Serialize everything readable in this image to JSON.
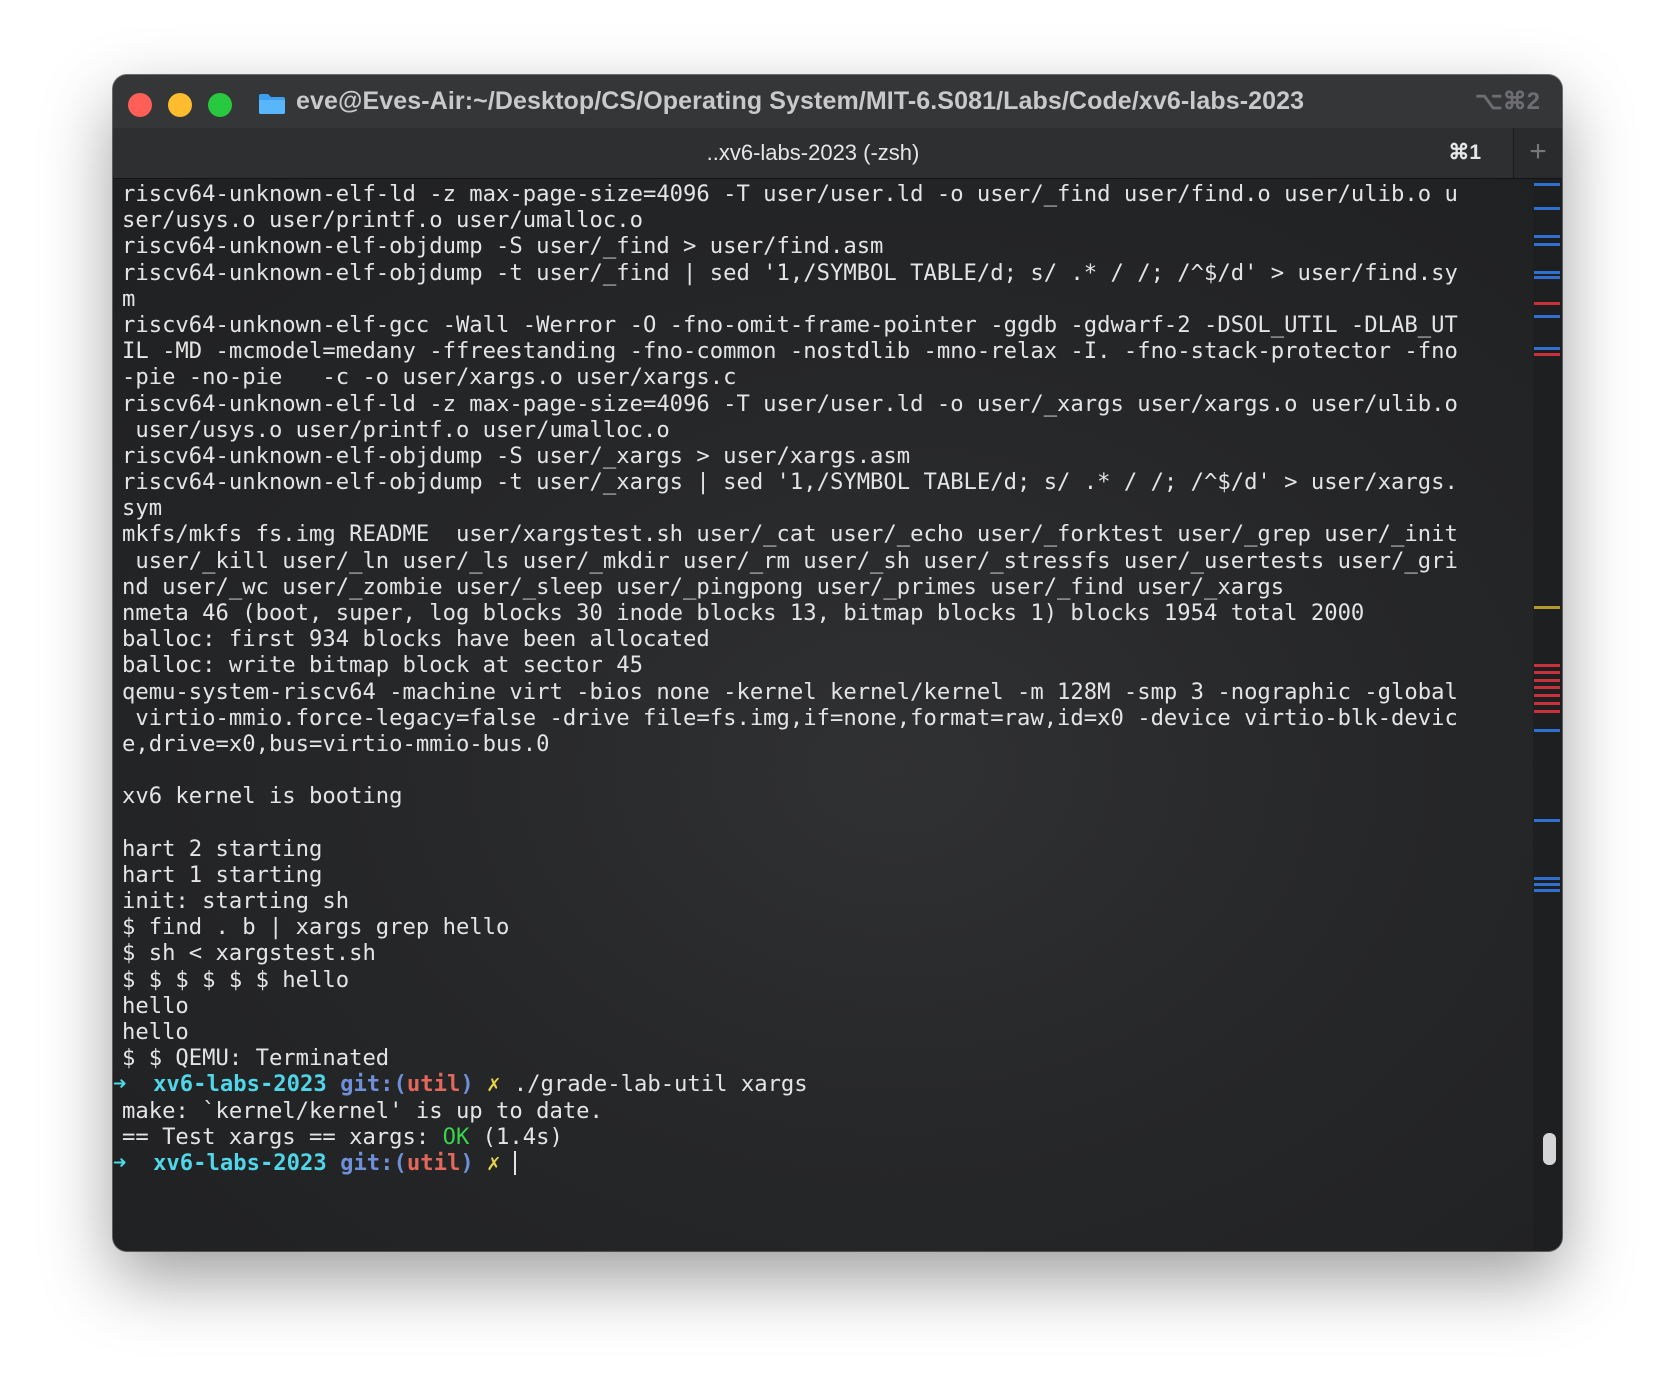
{
  "window": {
    "title": "eve@Eves-Air:~/Desktop/CS/Operating System/MIT-6.S081/Labs/Code/xv6-labs-2023",
    "shortcut": "⌥⌘2"
  },
  "tab": {
    "label": "..xv6-labs-2023 (-zsh)",
    "shortcut": "⌘1",
    "new_tab": "+"
  },
  "colors": {
    "prompt_arrow": "#4cd9e8",
    "prompt_dir": "#50d6e8",
    "prompt_git": "#6f8fd8",
    "prompt_branch": "#e2685c",
    "prompt_dirty": "#e6d34a",
    "ok": "#39d24f",
    "mark_blue": "#2f6fd0",
    "mark_red": "#c8303a"
  },
  "terminal": {
    "lines": [
      "riscv64-unknown-elf-ld -z max-page-size=4096 -T user/user.ld -o user/_find user/find.o user/ulib.o u",
      "ser/usys.o user/printf.o user/umalloc.o",
      "riscv64-unknown-elf-objdump -S user/_find > user/find.asm",
      "riscv64-unknown-elf-objdump -t user/_find | sed '1,/SYMBOL TABLE/d; s/ .* / /; /^$/d' > user/find.sy",
      "m",
      "riscv64-unknown-elf-gcc -Wall -Werror -O -fno-omit-frame-pointer -ggdb -gdwarf-2 -DSOL_UTIL -DLAB_UT",
      "IL -MD -mcmodel=medany -ffreestanding -fno-common -nostdlib -mno-relax -I. -fno-stack-protector -fno",
      "-pie -no-pie   -c -o user/xargs.o user/xargs.c",
      "riscv64-unknown-elf-ld -z max-page-size=4096 -T user/user.ld -o user/_xargs user/xargs.o user/ulib.o",
      " user/usys.o user/printf.o user/umalloc.o",
      "riscv64-unknown-elf-objdump -S user/_xargs > user/xargs.asm",
      "riscv64-unknown-elf-objdump -t user/_xargs | sed '1,/SYMBOL TABLE/d; s/ .* / /; /^$/d' > user/xargs.",
      "sym",
      "mkfs/mkfs fs.img README  user/xargstest.sh user/_cat user/_echo user/_forktest user/_grep user/_init",
      " user/_kill user/_ln user/_ls user/_mkdir user/_rm user/_sh user/_stressfs user/_usertests user/_gri",
      "nd user/_wc user/_zombie user/_sleep user/_pingpong user/_primes user/_find user/_xargs",
      "nmeta 46 (boot, super, log blocks 30 inode blocks 13, bitmap blocks 1) blocks 1954 total 2000",
      "balloc: first 934 blocks have been allocated",
      "balloc: write bitmap block at sector 45",
      "qemu-system-riscv64 -machine virt -bios none -kernel kernel/kernel -m 128M -smp 3 -nographic -global",
      " virtio-mmio.force-legacy=false -drive file=fs.img,if=none,format=raw,id=x0 -device virtio-blk-devic",
      "e,drive=x0,bus=virtio-mmio-bus.0",
      "",
      "xv6 kernel is booting",
      "",
      "hart 2 starting",
      "hart 1 starting",
      "init: starting sh",
      "$ find . b | xargs grep hello",
      "$ sh < xargstest.sh",
      "$ $ $ $ $ $ hello",
      "hello",
      "hello",
      "$ $ QEMU: Terminated"
    ],
    "prompt1": {
      "arrow": "➜",
      "dir": "xv6-labs-2023",
      "git_open": "git:(",
      "branch": "util",
      "git_close": ")",
      "dirty": "✗",
      "command": "./grade-lab-util xargs"
    },
    "make_line": "make: `kernel/kernel' is up to date.",
    "test_prefix": "== Test xargs == xargs: ",
    "test_status": "OK",
    "test_time": "(1.4s)",
    "prompt2": {
      "arrow": "➜",
      "dir": "xv6-labs-2023",
      "git_open": "git:(",
      "branch": "util",
      "git_close": ")",
      "dirty": "✗"
    }
  }
}
